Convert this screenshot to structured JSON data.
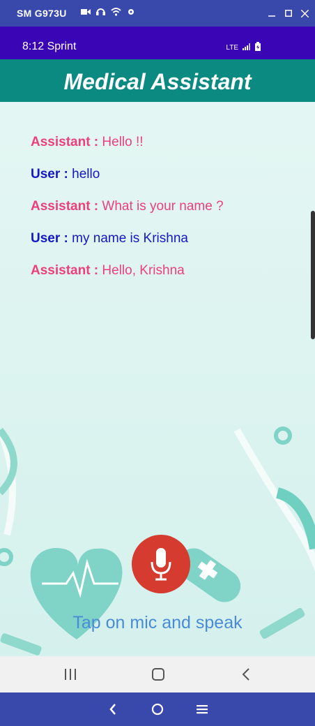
{
  "window": {
    "title": "SM G973U"
  },
  "status_bar": {
    "time": "8:12 Sprint",
    "network": "LTE"
  },
  "app": {
    "title": "Medical Assistant"
  },
  "conversation": [
    {
      "speaker": "Assistant :",
      "text": "Hello !!",
      "role": "assistant"
    },
    {
      "speaker": "User :",
      "text": "hello",
      "role": "user"
    },
    {
      "speaker": "Assistant :",
      "text": "What is your name ?",
      "role": "assistant"
    },
    {
      "speaker": "User :",
      "text": "my name is Krishna",
      "role": "user"
    },
    {
      "speaker": "Assistant :",
      "text": "Hello, Krishna",
      "role": "assistant"
    }
  ],
  "mic": {
    "icon": "mic-icon",
    "hint": "Tap on mic and speak"
  },
  "colors": {
    "assistant": "#ec407a",
    "user": "#1418c4",
    "appbar": "#0b8a82",
    "status_bar": "#3a05b4",
    "mic": "#d63b30"
  }
}
